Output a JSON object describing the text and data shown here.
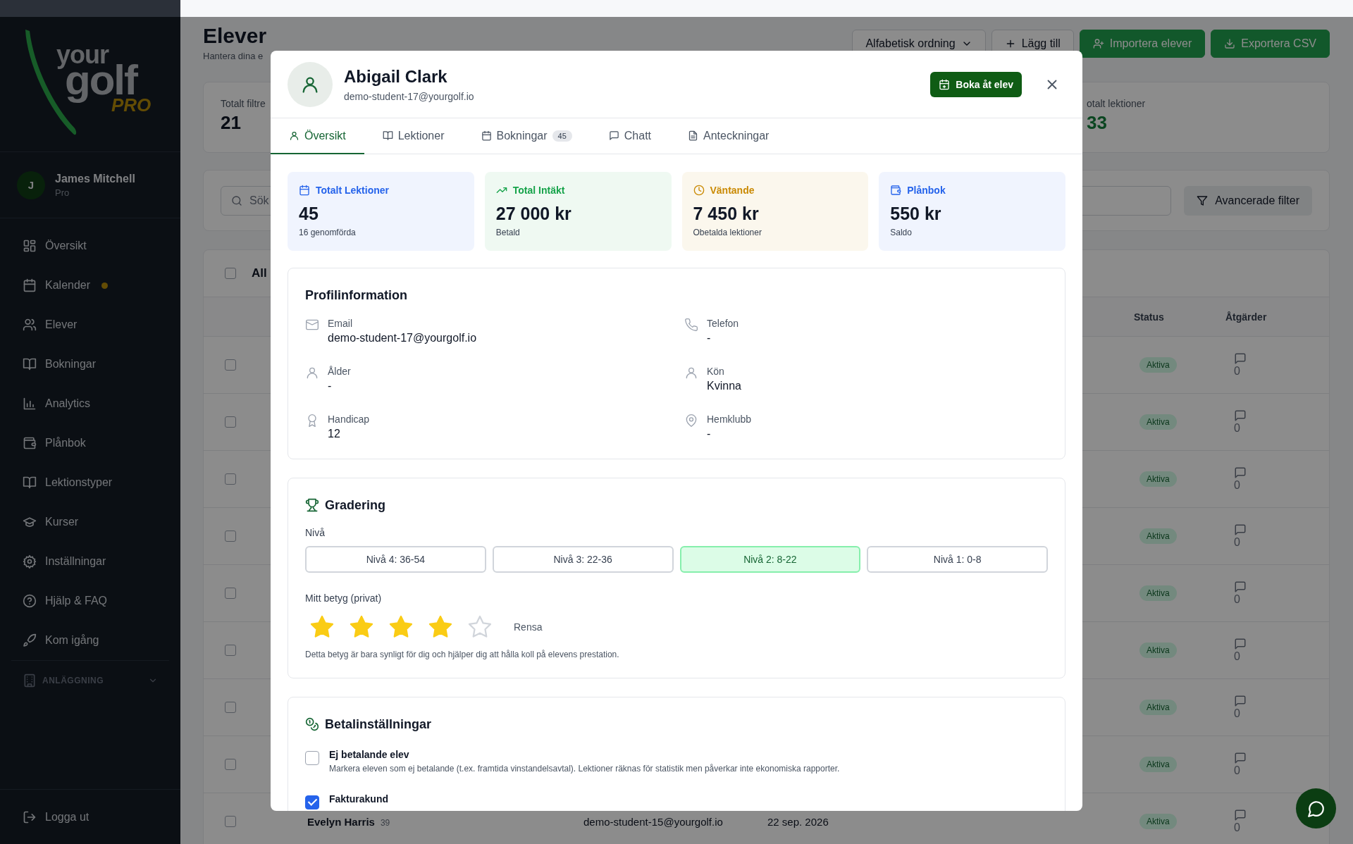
{
  "sidebar": {
    "logo": {
      "word1": "your",
      "word2": "golf",
      "tag": "PRO"
    },
    "user": {
      "initial": "J",
      "name": "James Mitchell",
      "role": "Pro"
    },
    "items": [
      {
        "label": "Översikt",
        "dot": false
      },
      {
        "label": "Kalender",
        "dot": true
      },
      {
        "label": "Elever",
        "dot": false
      },
      {
        "label": "Bokningar",
        "dot": false
      },
      {
        "label": "Analytics",
        "dot": false
      },
      {
        "label": "Plånbok",
        "dot": false
      },
      {
        "label": "Lektionstyper",
        "dot": false
      },
      {
        "label": "Kurser",
        "dot": false
      },
      {
        "label": "Inställningar",
        "dot": false
      },
      {
        "label": "Hjälp & FAQ",
        "dot": false
      },
      {
        "label": "Kom igång",
        "dot": false
      }
    ],
    "section": {
      "label": "ANLÄGGNING",
      "expanded": false
    },
    "logout": "Logga ut"
  },
  "page": {
    "title": "Elever",
    "subtitle": "Hantera dina e",
    "sort": "Alfabetisk ordning",
    "add": "Lägg till",
    "import": "Importera elever",
    "export": "Exportera CSV",
    "stats": [
      {
        "label": "Totalt filtre",
        "value": "21"
      },
      {
        "label": "otalt lektioner",
        "value": "33"
      }
    ],
    "search": {
      "placeholder": "Sök"
    },
    "filter": "Avancerade filter",
    "table": {
      "select_all": {
        "label": "All",
        "checked": false
      },
      "columns": [
        "Status",
        "Åtgärder"
      ],
      "rows": [
        {
          "checked": false,
          "status": "Aktiva",
          "comments": "0"
        },
        {
          "checked": false,
          "status": "Aktiva",
          "comments": "0"
        },
        {
          "checked": false,
          "status": "Aktiva",
          "comments": "0"
        },
        {
          "checked": false,
          "status": "Aktiva",
          "comments": "0"
        },
        {
          "checked": false,
          "status": "Aktiva",
          "comments": "0"
        },
        {
          "checked": false,
          "status": "Aktiva",
          "comments": "0"
        },
        {
          "checked": false,
          "status": "Aktiva",
          "comments": "0"
        },
        {
          "checked": false,
          "status": "Aktiva",
          "comments": "0"
        },
        {
          "checked": false,
          "name": "Evelyn Harris",
          "age": "39",
          "email": "demo-student-15@yourgolf.io",
          "date": "22 sep. 2026",
          "status": "Aktiva",
          "comments": "0"
        }
      ]
    }
  },
  "modal": {
    "name": "Abigail Clark",
    "email": "demo-student-17@yourgolf.io",
    "book_button": "Boka åt elev",
    "tabs": [
      {
        "label": "Översikt",
        "selected": true
      },
      {
        "label": "Lektioner",
        "selected": false
      },
      {
        "label": "Bokningar",
        "selected": false,
        "badge": "45"
      },
      {
        "label": "Chatt",
        "selected": false
      },
      {
        "label": "Anteckningar",
        "selected": false
      }
    ],
    "cards": [
      {
        "title": "Totalt Lektioner",
        "value": "45",
        "sub": "16 genomförda",
        "color": "#2563eb"
      },
      {
        "title": "Total Intäkt",
        "value": "27 000 kr",
        "sub": "Betald",
        "color": "#16a34a"
      },
      {
        "title": "Väntande",
        "value": "7 450 kr",
        "sub": "Obetalda lektioner",
        "color": "#ca8a04"
      },
      {
        "title": "Plånbok",
        "value": "550 kr",
        "sub": "Saldo",
        "color": "#2563eb"
      }
    ],
    "profile": {
      "title": "Profilinformation",
      "fields": [
        {
          "label": "Email",
          "value": "demo-student-17@yourgolf.io"
        },
        {
          "label": "Telefon",
          "value": "-"
        },
        {
          "label": "Ålder",
          "value": "-"
        },
        {
          "label": "Kön",
          "value": "Kvinna"
        },
        {
          "label": "Handicap",
          "value": "12"
        },
        {
          "label": "Hemklubb",
          "value": "-"
        }
      ]
    },
    "grading": {
      "title": "Gradering",
      "level_label": "Nivå",
      "levels": [
        {
          "label": "Nivå 4: 36-54",
          "selected": false
        },
        {
          "label": "Nivå 3: 22-36",
          "selected": false
        },
        {
          "label": "Nivå 2: 8-22",
          "selected": true
        },
        {
          "label": "Nivå 1: 0-8",
          "selected": false
        }
      ],
      "rating_label": "Mitt betyg (privat)",
      "stars": 4,
      "clear": "Rensa",
      "note": "Detta betyg är bara synligt för dig och hjälper dig att hålla koll på elevens prestation."
    },
    "payment": {
      "title": "Betalinställningar",
      "options": [
        {
          "label": "Ej betalande elev",
          "description": "Markera eleven som ej betalande (t.ex. framtida vinstandelsavtal). Lektioner räknas för statistik men påverkar inte ekonomiska rapporter.",
          "checked": false
        },
        {
          "label": "Fakturakund",
          "checked": true
        }
      ]
    }
  }
}
